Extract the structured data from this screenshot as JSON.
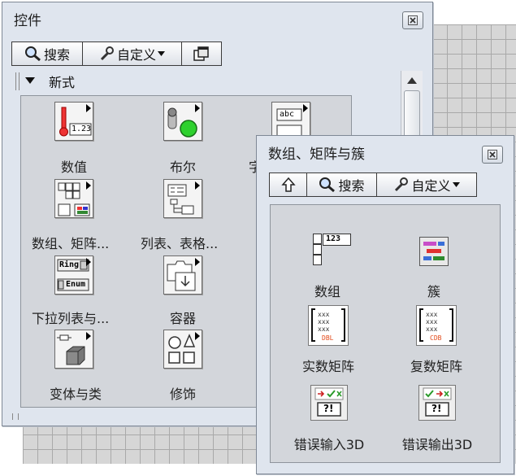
{
  "controls_palette": {
    "title": "控件",
    "toolbar": {
      "search_label": "搜索",
      "customize_label": "自定义"
    },
    "category": "新式",
    "items": [
      {
        "label": "数值",
        "icon": "numeric-icon"
      },
      {
        "label": "布尔",
        "icon": "boolean-icon"
      },
      {
        "label": "字",
        "icon": "string-path-icon"
      },
      {
        "label": "数组、矩阵...",
        "icon": "array-matrix-cluster-icon"
      },
      {
        "label": "列表、表格...",
        "icon": "list-table-tree-icon"
      },
      {
        "label": "下拉列表与...",
        "icon": "ring-enum-icon"
      },
      {
        "label": "容器",
        "icon": "containers-icon"
      },
      {
        "label": "变体与类",
        "icon": "variant-class-icon"
      },
      {
        "label": "修饰",
        "icon": "decorations-icon"
      }
    ]
  },
  "array_palette": {
    "title": "数组、矩阵与簇",
    "toolbar": {
      "search_label": "搜索",
      "customize_label": "自定义"
    },
    "items": [
      {
        "label": "数组",
        "icon": "array-icon"
      },
      {
        "label": "簇",
        "icon": "cluster-icon"
      },
      {
        "label": "实数矩阵",
        "icon": "real-matrix-icon"
      },
      {
        "label": "复数矩阵",
        "icon": "complex-matrix-icon"
      },
      {
        "label": "错误输入3D",
        "icon": "error-in-icon"
      },
      {
        "label": "错误输出3D",
        "icon": "error-out-icon"
      }
    ]
  },
  "icon_text": {
    "numeric": "1.23",
    "array": "123",
    "ring": "Ring",
    "enum": "Enum",
    "string": "abc",
    "dbl": "DBL",
    "cdb": "CDB",
    "error": "?!"
  }
}
